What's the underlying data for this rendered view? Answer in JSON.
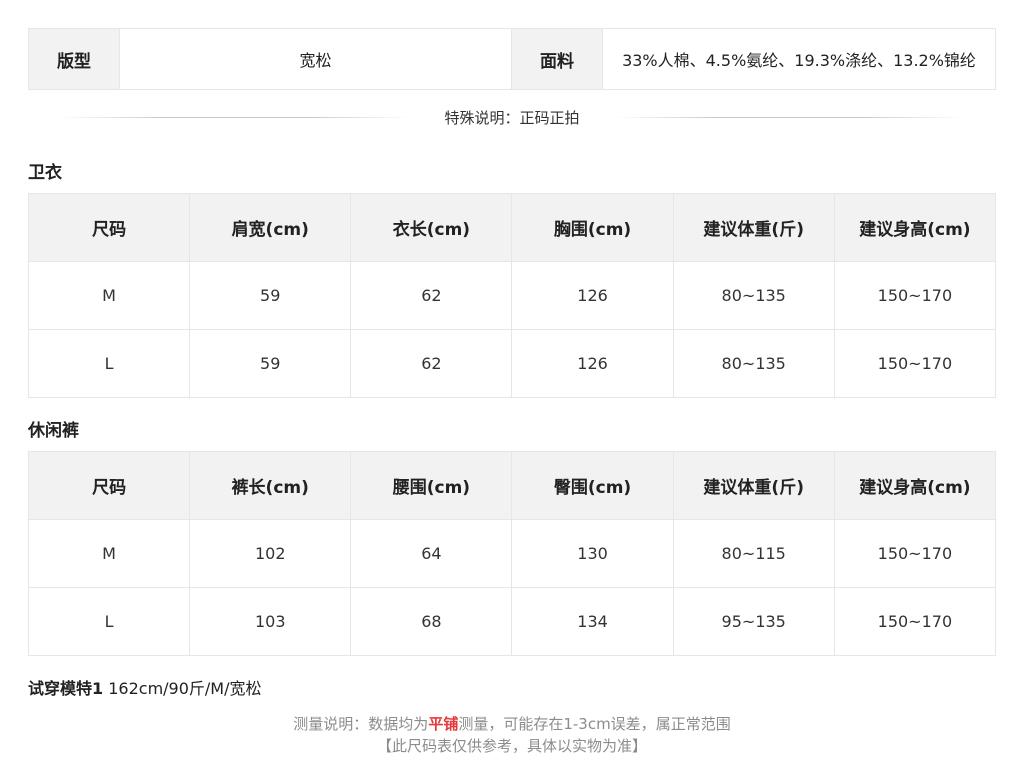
{
  "attributes": {
    "fit_label": "版型",
    "fit_value": "宽松",
    "fabric_label": "面料",
    "fabric_value": "33%人棉、4.5%氨纶、19.3%涤纶、13.2%锦纶"
  },
  "special_note": "特殊说明：正码正拍",
  "hoodie": {
    "title": "卫衣",
    "headers": [
      "尺码",
      "肩宽(cm)",
      "衣长(cm)",
      "胸围(cm)",
      "建议体重(斤)",
      "建议身高(cm)"
    ],
    "rows": [
      [
        "M",
        "59",
        "62",
        "126",
        "80~135",
        "150~170"
      ],
      [
        "L",
        "59",
        "62",
        "126",
        "80~135",
        "150~170"
      ]
    ]
  },
  "pants": {
    "title": "休闲裤",
    "headers": [
      "尺码",
      "裤长(cm)",
      "腰围(cm)",
      "臀围(cm)",
      "建议体重(斤)",
      "建议身高(cm)"
    ],
    "rows": [
      [
        "M",
        "102",
        "64",
        "130",
        "80~115",
        "150~170"
      ],
      [
        "L",
        "103",
        "68",
        "134",
        "95~135",
        "150~170"
      ]
    ]
  },
  "model": {
    "label": "试穿模特1",
    "info": " 162cm/90斤/M/宽松"
  },
  "measure_note": {
    "prefix": "测量说明：数据均为",
    "highlight": "平铺",
    "suffix": "测量，可能存在1-3cm误差，属正常范围"
  },
  "reference_note": "【此尺码表仅供参考，具体以实物为准】",
  "colors": {
    "header_bg": "#f2f2f2",
    "border": "#e6e6e6",
    "highlight": "#e4393c",
    "note_gray": "#8c8c8c"
  }
}
